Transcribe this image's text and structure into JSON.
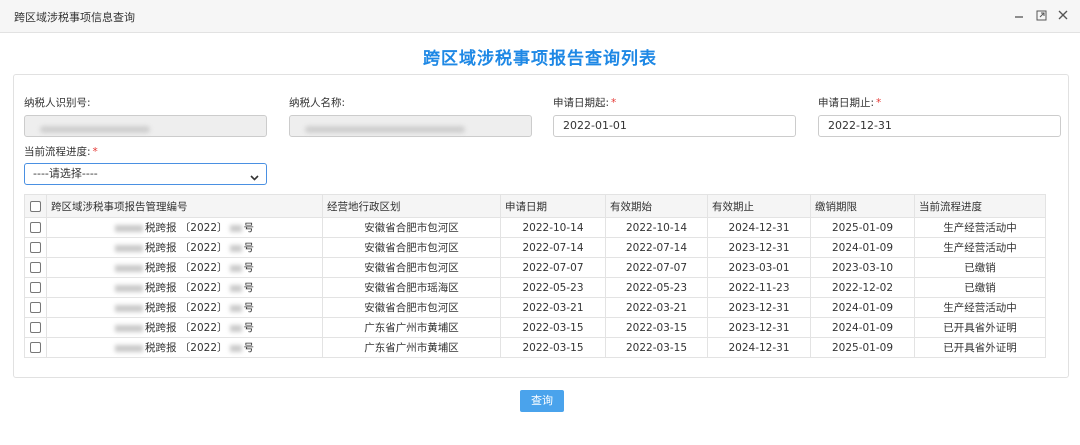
{
  "window": {
    "title": "跨区域涉税事项信息查询",
    "controls": [
      "minimize-icon",
      "maximize-icon",
      "close-icon"
    ]
  },
  "page_title": "跨区域涉税事项报告查询列表",
  "form": {
    "taxpayer_id_label": "纳税人识别号:",
    "taxpayer_name_label": "纳税人名称:",
    "date_start_label": "申请日期起:",
    "date_start_value": "2022-01-01",
    "date_end_label": "申请日期止:",
    "date_end_value": "2022-12-31",
    "progress_label": "当前流程进度:",
    "progress_value": "----请选择----",
    "required_mark": "*"
  },
  "table": {
    "headers": [
      "跨区域涉税事项报告管理编号",
      "经营地行政区划",
      "申请日期",
      "有效期始",
      "有效期止",
      "缴销期限",
      "当前流程进度"
    ],
    "rows": [
      {
        "prefix": "税跨报",
        "year": "〔2022〕",
        "suffix": "号",
        "region": "安徽省合肥市包河区",
        "apply": "2022-10-14",
        "start": "2022-10-14",
        "end": "2024-12-31",
        "deadline": "2025-01-09",
        "status": "生产经营活动中"
      },
      {
        "prefix": "税跨报",
        "year": "〔2022〕",
        "suffix": "号",
        "region": "安徽省合肥市包河区",
        "apply": "2022-07-14",
        "start": "2022-07-14",
        "end": "2023-12-31",
        "deadline": "2024-01-09",
        "status": "生产经营活动中"
      },
      {
        "prefix": "税跨报",
        "year": "〔2022〕",
        "suffix": "号",
        "region": "安徽省合肥市包河区",
        "apply": "2022-07-07",
        "start": "2022-07-07",
        "end": "2023-03-01",
        "deadline": "2023-03-10",
        "status": "已缴销"
      },
      {
        "prefix": "税跨报",
        "year": "〔2022〕",
        "suffix": "号",
        "region": "安徽省合肥市瑶海区",
        "apply": "2022-05-23",
        "start": "2022-05-23",
        "end": "2022-11-23",
        "deadline": "2022-12-02",
        "status": "已缴销"
      },
      {
        "prefix": "税跨报",
        "year": "〔2022〕",
        "suffix": "号",
        "region": "安徽省合肥市包河区",
        "apply": "2022-03-21",
        "start": "2022-03-21",
        "end": "2023-12-31",
        "deadline": "2024-01-09",
        "status": "生产经营活动中"
      },
      {
        "prefix": "税跨报",
        "year": "〔2022〕",
        "suffix": "号",
        "region": "广东省广州市黄埔区",
        "apply": "2022-03-15",
        "start": "2022-03-15",
        "end": "2023-12-31",
        "deadline": "2024-01-09",
        "status": "已开具省外证明"
      },
      {
        "prefix": "税跨报",
        "year": "〔2022〕",
        "suffix": "号",
        "region": "广东省广州市黄埔区",
        "apply": "2022-03-15",
        "start": "2022-03-15",
        "end": "2024-12-31",
        "deadline": "2025-01-09",
        "status": "已开具省外证明"
      }
    ]
  },
  "query_button": "查询",
  "colors": {
    "title": "#1e88e5",
    "button": "#4aa3ec",
    "required": "#e53935"
  }
}
